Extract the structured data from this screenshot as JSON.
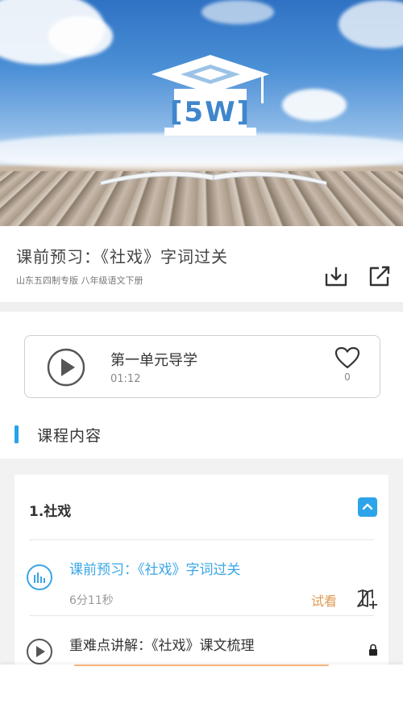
{
  "hero": {
    "image": "course-banner",
    "logo": "graduation-cap-logo"
  },
  "course": {
    "title": "课前预习：《社戏》字词过关",
    "subtitle": "山东五四制专版 八年级语文下册",
    "download_icon": "download-icon",
    "share_icon": "share-icon"
  },
  "audio": {
    "title": "第一单元导学",
    "time": "01:12",
    "likes": "0",
    "play_icon": "play-icon",
    "like_icon": "heart-icon"
  },
  "section": {
    "title": "课程内容"
  },
  "chapter": {
    "title": "1.社戏",
    "expanded": true,
    "lessons": [
      {
        "title": "课前预习：《社戏》字词过关",
        "duration": "6分11秒",
        "action": "试看",
        "active": true
      },
      {
        "title": "重难点讲解：《社戏》课文梳理",
        "locked": true
      }
    ]
  },
  "colors": {
    "accent": "#2ba4ea",
    "active_text": "#3aa6e6",
    "trial": "#e09a52"
  }
}
